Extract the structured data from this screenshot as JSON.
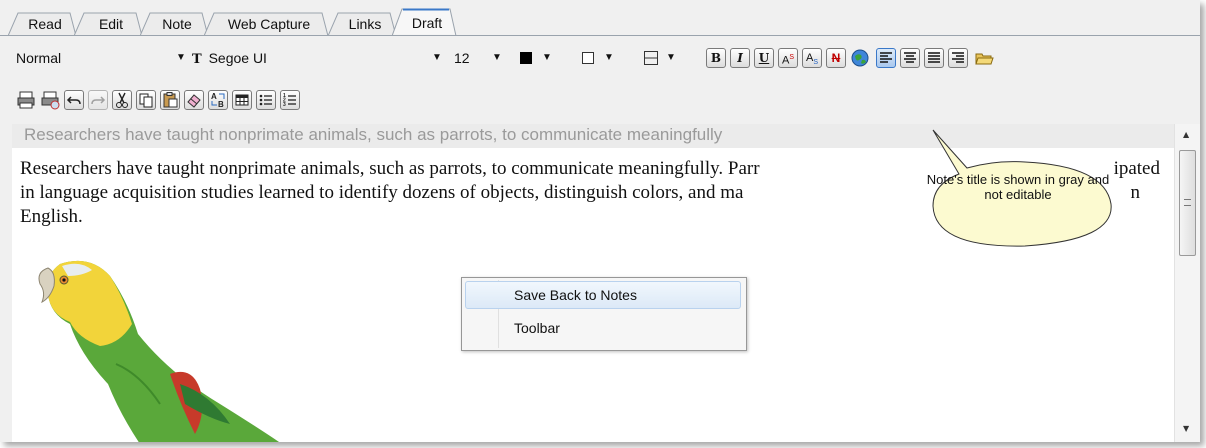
{
  "tabs": [
    {
      "label": "Read"
    },
    {
      "label": "Edit"
    },
    {
      "label": "Note"
    },
    {
      "label": "Web Capture"
    },
    {
      "label": "Links"
    },
    {
      "label": "Draft"
    }
  ],
  "active_tab": "Draft",
  "toolbar": {
    "style_value": "Normal",
    "font_value": "Segoe UI",
    "size_value": "12",
    "text_color": "#000000",
    "bg_color": "#ffffff",
    "bold_label": "B",
    "italic_label": "I",
    "underline_label": "U",
    "superscript_label": "A",
    "superscript_mark": "S",
    "subscript_label": "A",
    "subscript_mark": "S",
    "strike_label": "N",
    "accent_color": "#3a78c8"
  },
  "note": {
    "title": "Researchers have taught nonprimate animals, such as parrots, to communicate meaningfully",
    "body_line1": "Researchers have taught nonprimate animals, such as parrots, to communicate meaningfully. Parr",
    "body_line1_end": "ipated",
    "body_line2": "in language acquisition studies learned to identify dozens of objects, distinguish colors, and ma",
    "body_line2_end": "n",
    "body_line3": "English."
  },
  "context_menu": {
    "items": [
      {
        "label": "Save Back to Notes",
        "highlighted": true
      },
      {
        "label": "Toolbar",
        "highlighted": false
      }
    ]
  },
  "callout": {
    "text": "Note's title is shown in gray and not editable"
  }
}
